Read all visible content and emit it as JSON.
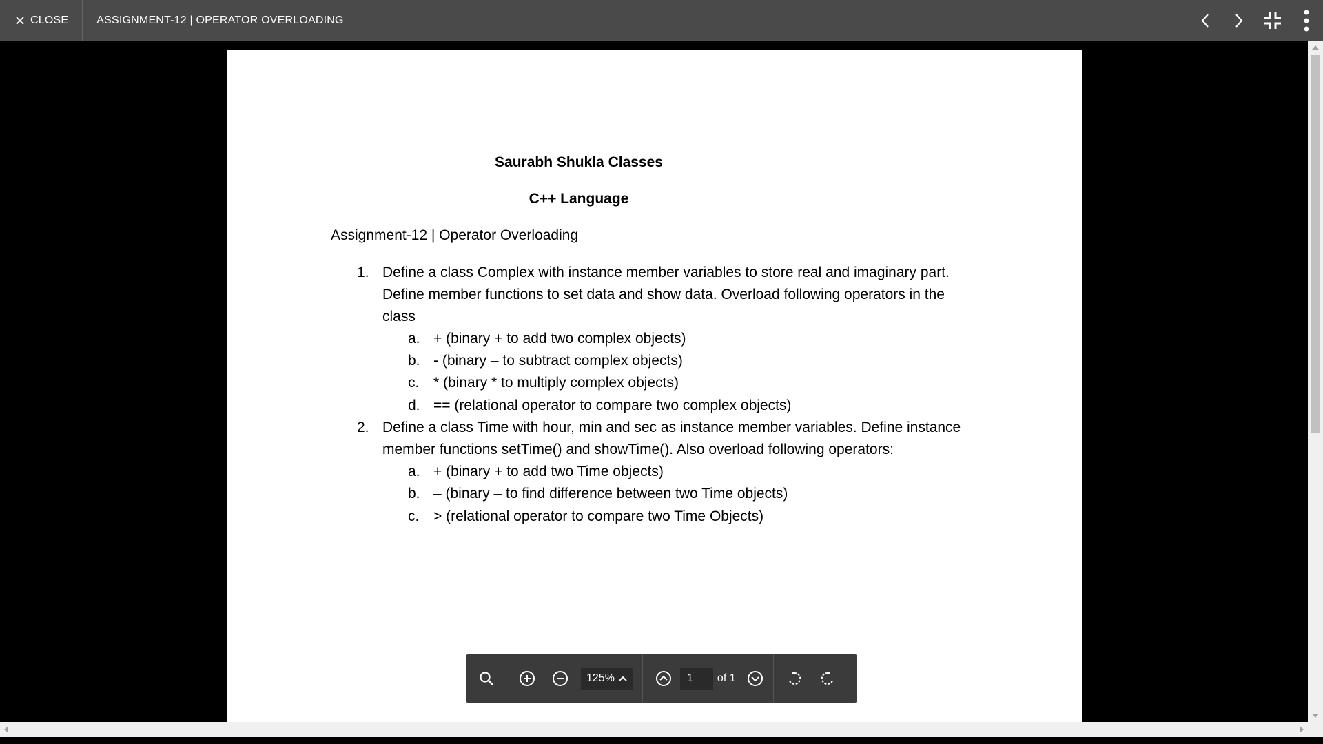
{
  "header": {
    "close_label": "CLOSE",
    "title": "ASSIGNMENT-12 | OPERATOR OVERLOADING",
    "icons": [
      "chevron-left-icon",
      "chevron-right-icon",
      "exit-fullscreen-icon",
      "more-vert-icon"
    ]
  },
  "document": {
    "heading1": "Saurabh Shukla Classes",
    "heading2": "C++ Language",
    "subtitle": "Assignment-12 | Operator Overloading",
    "q1": {
      "number": "1.",
      "lines": [
        "Define a class Complex with instance member variables to store real and imaginary part.",
        "Define member functions to set data and show data. Overload following operators in the",
        "class"
      ],
      "items": [
        {
          "marker": "a.",
          "text": "+ (binary + to add two complex objects)"
        },
        {
          "marker": "b.",
          "text": "-  (binary – to subtract complex objects)"
        },
        {
          "marker": "c.",
          "text": "* (binary * to multiply complex objects)"
        },
        {
          "marker": "d.",
          "text": "== (relational operator to compare two complex objects)"
        }
      ]
    },
    "q2": {
      "number": "2.",
      "lines": [
        "Define a class Time with hour, min and sec as instance member variables. Define instance",
        "member functions setTime() and showTime(). Also overload following operators:"
      ],
      "items": [
        {
          "marker": "a.",
          "text": "+ (binary + to add two Time objects)"
        },
        {
          "marker": "b.",
          "text": "– (binary – to find difference between two Time objects)"
        },
        {
          "marker": "c.",
          "text": "> (relational operator to compare two Time Objects)"
        }
      ]
    }
  },
  "toolbar": {
    "zoom": "125%",
    "page_current": "1",
    "page_of": "of 1",
    "icons": [
      "search-icon",
      "zoom-in-icon",
      "zoom-out-icon",
      "chevron-up-icon",
      "page-up-icon",
      "page-down-icon",
      "rotate-left-icon",
      "rotate-right-icon"
    ]
  },
  "colors": {
    "topbar": "#4a4a4a",
    "toolbar": "#3b3b3b",
    "background": "#000000",
    "page": "#ffffff"
  }
}
